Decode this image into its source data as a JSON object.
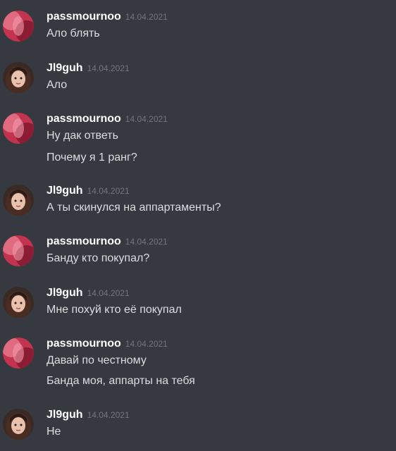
{
  "messages": [
    {
      "author": "passmournoo",
      "avatar": "pink-avatar-icon",
      "timestamp": "14.04.2021",
      "lines": [
        "Ало блять"
      ]
    },
    {
      "author": "Jl9guh",
      "avatar": "girl-avatar-icon",
      "timestamp": "14.04.2021",
      "lines": [
        "Ало"
      ]
    },
    {
      "author": "passmournoo",
      "avatar": "pink-avatar-icon",
      "timestamp": "14.04.2021",
      "lines": [
        "Ну дак ответь",
        "Почему я 1 ранг?"
      ]
    },
    {
      "author": "Jl9guh",
      "avatar": "girl-avatar-icon",
      "timestamp": "14.04.2021",
      "lines": [
        "А ты скинулся на аппартаменты?"
      ]
    },
    {
      "author": "passmournoo",
      "avatar": "pink-avatar-icon",
      "timestamp": "14.04.2021",
      "lines": [
        "Банду кто покупал?"
      ]
    },
    {
      "author": "Jl9guh",
      "avatar": "girl-avatar-icon",
      "timestamp": "14.04.2021",
      "lines": [
        "Мне похуй кто её покупал"
      ]
    },
    {
      "author": "passmournoo",
      "avatar": "pink-avatar-icon",
      "timestamp": "14.04.2021",
      "lines": [
        "Давай по честному",
        "Банда моя, аппарты на тебя"
      ]
    },
    {
      "author": "Jl9guh",
      "avatar": "girl-avatar-icon",
      "timestamp": "14.04.2021",
      "lines": [
        "Не"
      ]
    }
  ],
  "colors": {
    "background": "#36393f",
    "username": "#ffffff",
    "timestamp": "#72767d",
    "text": "#dcddde"
  }
}
